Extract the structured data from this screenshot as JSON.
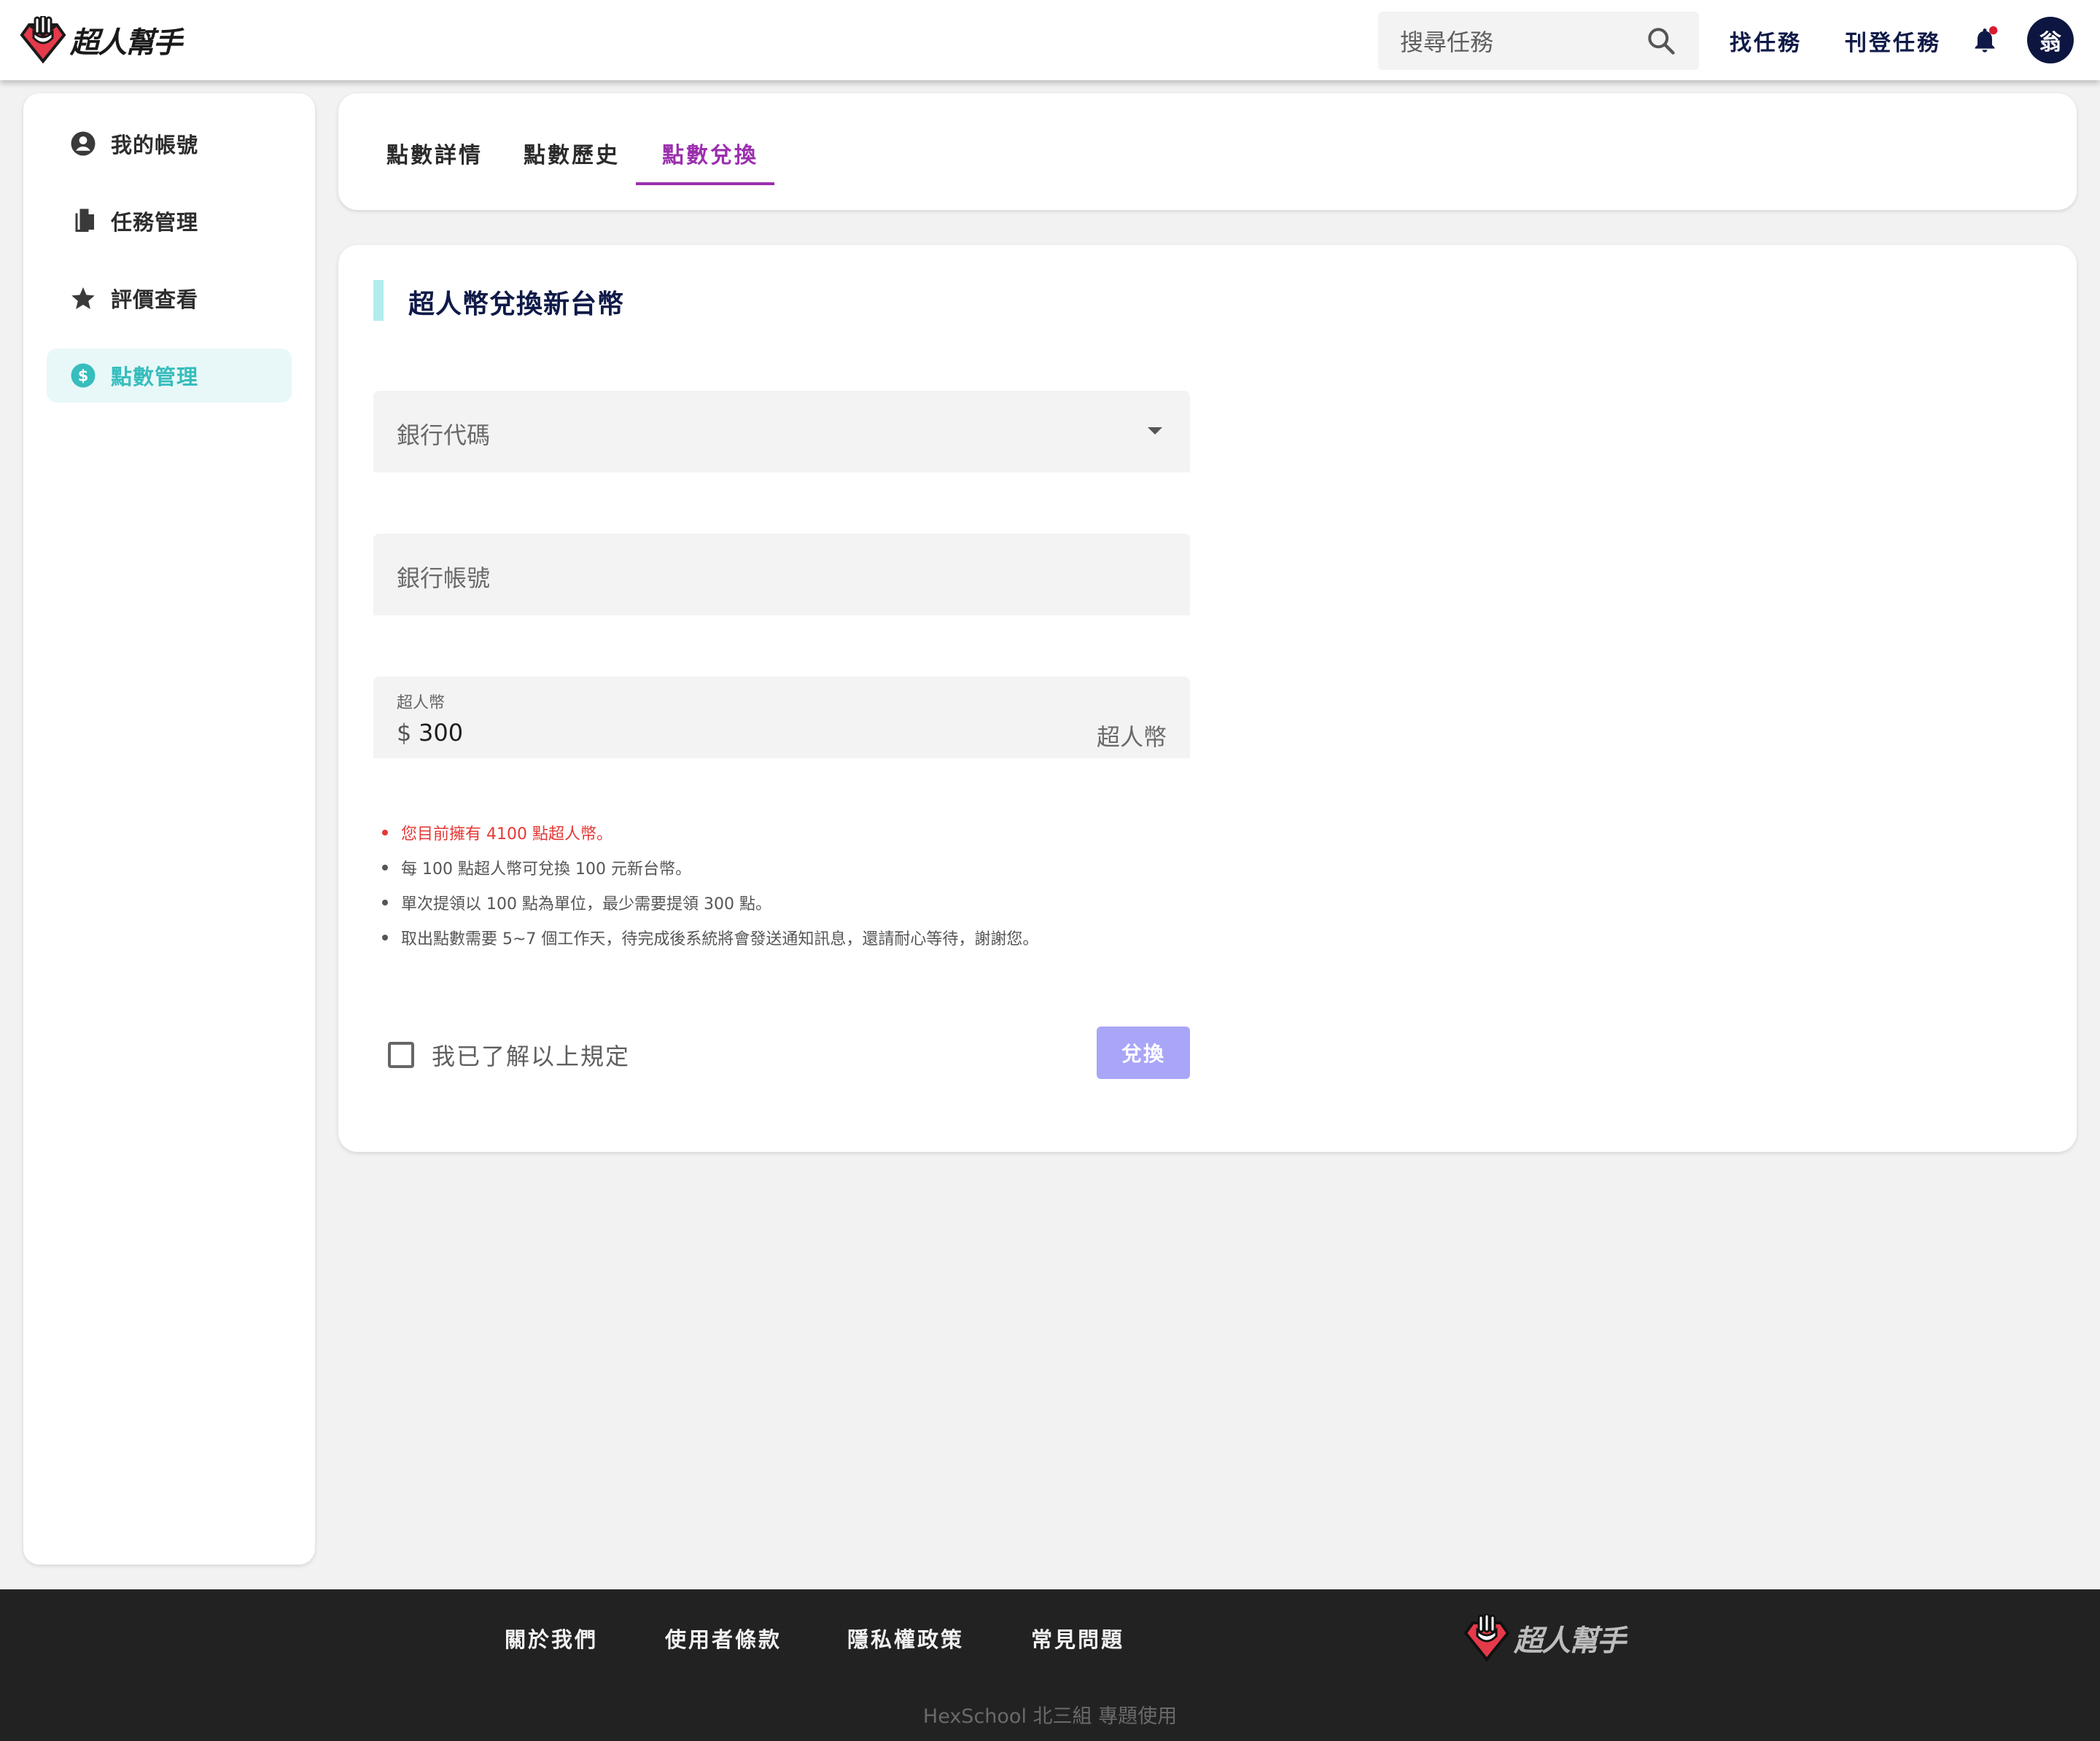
{
  "brand": {
    "name": "超人幫手",
    "primary": "#0f1a48",
    "accent": "#9b2fae",
    "teal": "#37bdbd"
  },
  "header": {
    "search_placeholder": "搜尋任務",
    "nav": [
      "找任務",
      "刊登任務"
    ],
    "avatar_initial": "翁"
  },
  "sidebar": {
    "items": [
      {
        "label": "我的帳號",
        "icon": "account-circle-icon"
      },
      {
        "label": "任務管理",
        "icon": "document-icon"
      },
      {
        "label": "評價查看",
        "icon": "star-icon"
      },
      {
        "label": "點數管理",
        "icon": "dollar-circle-icon",
        "active": true
      }
    ]
  },
  "tabs": [
    {
      "label": "點數詳情"
    },
    {
      "label": "點數歷史"
    },
    {
      "label": "點數兌換",
      "active": true
    }
  ],
  "form": {
    "title": "超人幣兌換新台幣",
    "bank_code_placeholder": "銀行代碼",
    "bank_account_placeholder": "銀行帳號",
    "coin_label": "超人幣",
    "coin_prefix": "$",
    "coin_value": "300",
    "coin_suffix": "超人幣",
    "notes": [
      "您目前擁有 4100 點超人幣。",
      "每 100 點超人幣可兌換 100 元新台幣。",
      "單次提領以 100 點為單位，最少需要提領 300 點。",
      "取出點數需要 5~7 個工作天，待完成後系統將會發送通知訊息，還請耐心等待，謝謝您。"
    ],
    "agree_label": "我已了解以上規定",
    "submit_label": "兌換"
  },
  "footer": {
    "links": [
      "關於我們",
      "使用者條款",
      "隱私權政策",
      "常見問題"
    ],
    "copyright": "HexSchool 北三組 專題使用"
  }
}
